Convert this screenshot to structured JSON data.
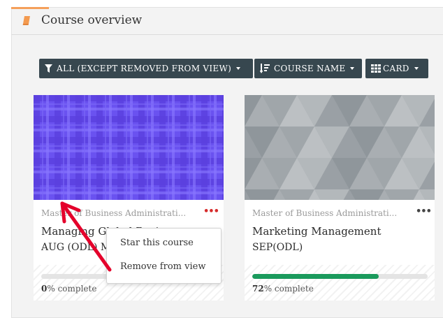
{
  "header": {
    "title": "Course overview",
    "icon": "book-icon",
    "accent_color": "#f5a05a"
  },
  "toolbar": {
    "filter_label": "ALL (EXCEPT REMOVED FROM VIEW)",
    "sort_label": "COURSE NAME",
    "view_label": "CARD",
    "colors": {
      "button_bg": "#37474f",
      "text": "#ffffff"
    }
  },
  "courses": [
    {
      "category": "Master of Business Administrati...",
      "title_line1": "Managing Global Business",
      "title_line2": "AUG (ODL) M",
      "progress": 0,
      "progress_bold": "0",
      "progress_suffix": "% complete",
      "image_color": "#6a4fe8",
      "menu_dots": "•••"
    },
    {
      "category": "Master of Business Administrati...",
      "title_line1": "Marketing Management",
      "title_line2": "SEP(ODL)",
      "progress": 72,
      "progress_bold": "72",
      "progress_suffix": "% complete",
      "image_color": "#9ea4a8",
      "menu_dots": "•••"
    }
  ],
  "course_menu": {
    "items": [
      "Star this course",
      "Remove from view"
    ]
  },
  "annotation": {
    "arrow_color": "#e4002b"
  }
}
